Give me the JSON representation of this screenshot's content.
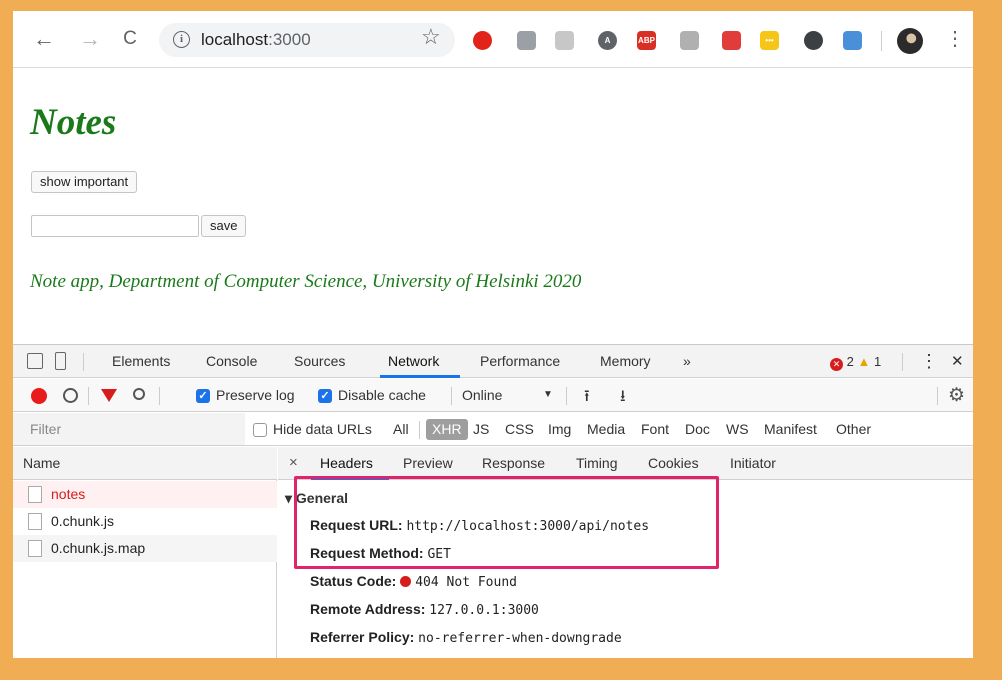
{
  "browser": {
    "back_icon": "←",
    "forward_icon": "→",
    "reload_icon": "C",
    "url_host": "localhost",
    "url_port": ":3000",
    "star_icon": "☆",
    "menu_icon": "⋮",
    "extensions": [
      {
        "name": "opera-extension-icon",
        "color": "#e2231a",
        "glyph": ""
      },
      {
        "name": "shield-extension-icon",
        "color": "#9aa0a6",
        "glyph": ""
      },
      {
        "name": "timer-extension-icon",
        "color": "#c7c7c7",
        "glyph": ""
      },
      {
        "name": "accessibility-extension-icon",
        "color": "#5f6368",
        "glyph": "A"
      },
      {
        "name": "adblock-extension-icon",
        "color": "#d93025",
        "glyph": "ABP"
      },
      {
        "name": "tools-extension-icon",
        "color": "#b0b0b0",
        "glyph": ""
      },
      {
        "name": "puzzle-extension-icon",
        "color": "#e23b3b",
        "glyph": ""
      },
      {
        "name": "password-extension-icon",
        "color": "#f5c518",
        "glyph": "•••"
      },
      {
        "name": "sync-extension-icon",
        "color": "#3c4043",
        "glyph": ""
      },
      {
        "name": "react-devtools-extension-icon",
        "color": "#4a90d9",
        "glyph": ""
      }
    ]
  },
  "page": {
    "title": "Notes",
    "show_important_label": "show important",
    "note_input_value": "",
    "save_label": "save",
    "footer": "Note app, Department of Computer Science, University of Helsinki 2020"
  },
  "devtools": {
    "tabs": [
      "Elements",
      "Console",
      "Sources",
      "Network",
      "Performance",
      "Memory",
      "»"
    ],
    "active_tab": "Network",
    "error_count": "2",
    "warning_count": "1",
    "close_icon": "✕",
    "menu_icon": "⋮",
    "toolbar": {
      "preserve_log": "Preserve log",
      "disable_cache": "Disable cache",
      "throttling": "Online",
      "dropdown_icon": "▼",
      "upload_icon": "⭱",
      "download_icon": "⭳",
      "settings_icon": "⚙"
    },
    "filter": {
      "placeholder": "Filter",
      "hide_data_urls": "Hide data URLs",
      "types": [
        "All",
        "XHR",
        "JS",
        "CSS",
        "Img",
        "Media",
        "Font",
        "Doc",
        "WS",
        "Manifest",
        "Other"
      ],
      "active_type": "XHR"
    },
    "requests_header": "Name",
    "requests": [
      {
        "name": "notes",
        "error": true
      },
      {
        "name": "0.chunk.js",
        "error": false
      },
      {
        "name": "0.chunk.js.map",
        "error": false
      }
    ],
    "detail": {
      "close_icon": "×",
      "tabs": [
        "Headers",
        "Preview",
        "Response",
        "Timing",
        "Cookies",
        "Initiator"
      ],
      "active_tab": "Headers",
      "section_title": "▾ General",
      "general": [
        {
          "key": "Request URL:",
          "value": "http://localhost:3000/api/notes"
        },
        {
          "key": "Request Method:",
          "value": "GET"
        },
        {
          "key": "Status Code:",
          "value": "404 Not Found"
        },
        {
          "key": "Remote Address:",
          "value": "127.0.0.1:3000"
        },
        {
          "key": "Referrer Policy:",
          "value": "no-referrer-when-downgrade"
        }
      ]
    }
  },
  "colors": {
    "page_green": "#1a7a1a",
    "accent_blue": "#1a73e8",
    "error_red": "#d61c1c",
    "highlight_pink": "#e0246b",
    "background_orange": "#f0ad53"
  }
}
